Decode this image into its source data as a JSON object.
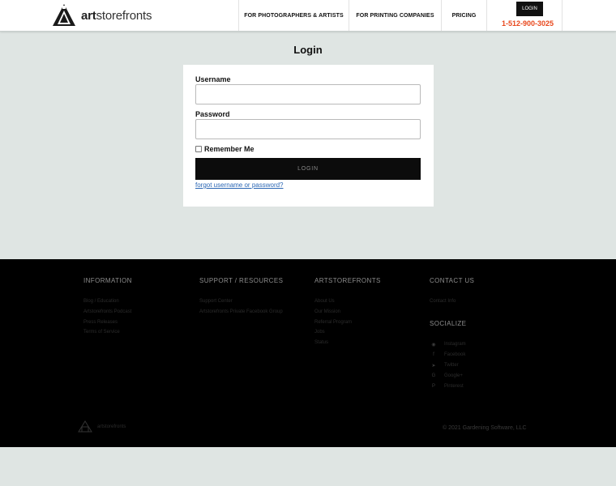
{
  "header": {
    "brand": {
      "prefix": "art",
      "suffix": "storefronts"
    },
    "nav": [
      {
        "label": "FOR PHOTOGRAPHERS & ARTISTS"
      },
      {
        "label": "FOR PRINTING COMPANIES"
      },
      {
        "label": "PRICING"
      }
    ],
    "login_label": "LOGIN",
    "phone": "1-512-900-3025",
    "phone_color": "#e8471c"
  },
  "login": {
    "title": "Login",
    "username_label": "Username",
    "username_value": "",
    "password_label": "Password",
    "password_value": "",
    "remember_label": "Remember Me",
    "remember_checked": false,
    "button_label": "LOGIN",
    "forgot_link": "forgot username or password?"
  },
  "footer": {
    "columns": [
      {
        "heading": "INFORMATION",
        "links": [
          "Blog / Education",
          "Artstorefronts Podcast",
          "Press Releases",
          "Terms of Service"
        ]
      },
      {
        "heading": "SUPPORT / RESOURCES",
        "links": [
          "Support Center",
          "Artstorefronts Private Facebook Group"
        ]
      },
      {
        "heading": "ARTSTOREFRONTS",
        "links": [
          "About Us",
          "Our Mission",
          "Referral Program",
          "Jobs",
          "Status"
        ]
      },
      {
        "heading": "CONTACT US",
        "links": [
          "Contact Info"
        ]
      }
    ],
    "social_heading": "SOCIALIZE",
    "social": [
      {
        "icon": "instagram-icon",
        "label": "Instagram"
      },
      {
        "icon": "facebook-icon",
        "label": "Facebook"
      },
      {
        "icon": "twitter-icon",
        "label": "Twitter"
      },
      {
        "icon": "google-icon",
        "label": "Google+"
      },
      {
        "icon": "pinterest-icon",
        "label": "Pinterest"
      }
    ],
    "bottom_logo_text": "artstorefronts",
    "copyright": "© 2021 Gardening Software, LLC"
  },
  "colors": {
    "background": "#dfe5e3",
    "footer": "#000000",
    "link": "#2a66b4",
    "button": "#0c0c0c"
  }
}
